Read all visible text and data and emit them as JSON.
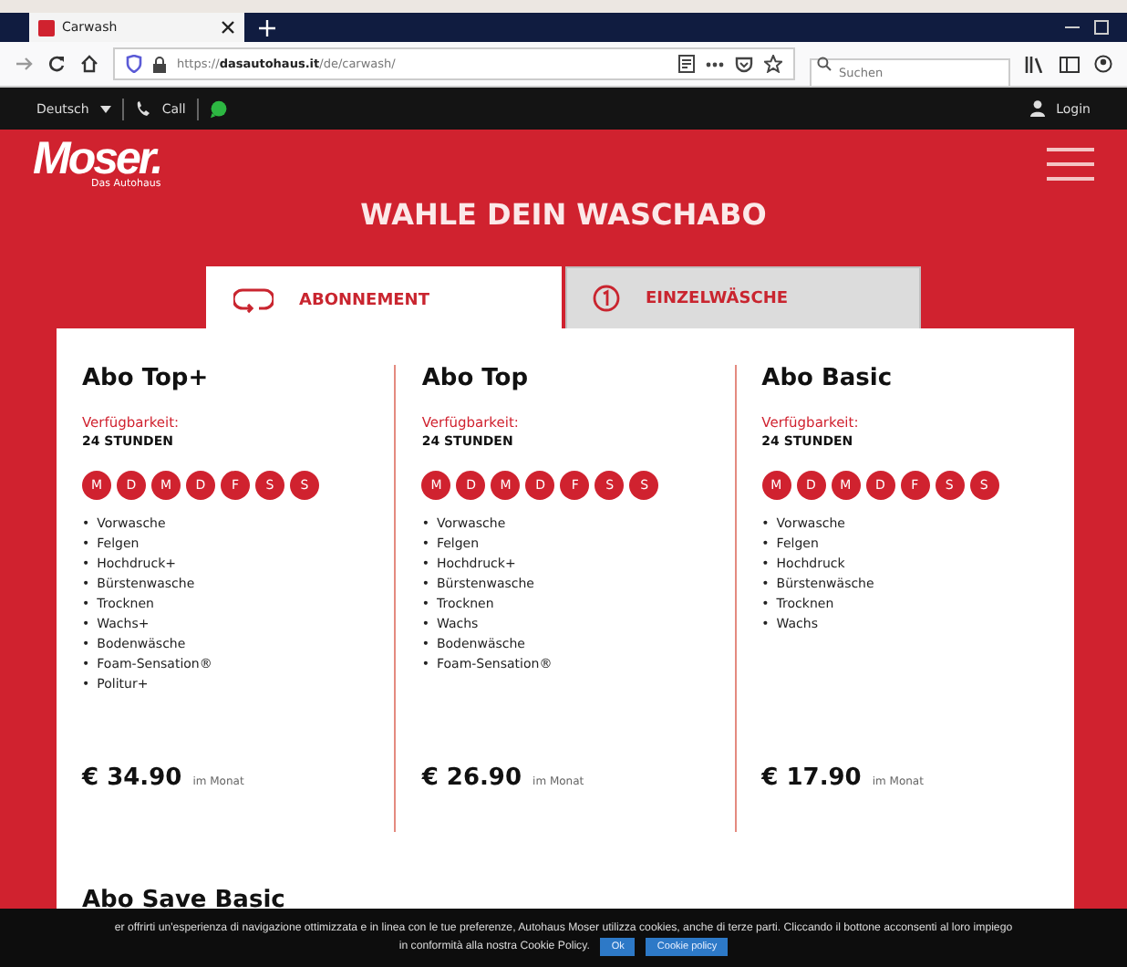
{
  "browser": {
    "tab_title": "Carwash",
    "url": "https://**dasautohaus.it**/de/carwash/",
    "search_placeholder": "Suchen"
  },
  "site_nav": {
    "language": "Deutsch",
    "call": "Call",
    "login": "Login"
  },
  "logo": {
    "name": "Moser.",
    "tagline": "Das Autohaus"
  },
  "title": "WAHLE DEIN WASCHABO",
  "bullet": "•",
  "tabs": [
    {
      "label": "ABONNEMENT",
      "kind": "repeat",
      "selected": true
    },
    {
      "label": "EINZELWÄSCHE",
      "kind": "single",
      "selected": false
    }
  ],
  "plans": [
    {
      "name": "Abo Top+",
      "availability_label": "Verfügbarkeit:",
      "availability": "24 STUNDEN",
      "days": [
        "M",
        "D",
        "M",
        "D",
        "F",
        "S",
        "S"
      ],
      "features": [
        "Vorwasche",
        "Felgen",
        "Hochdruck+",
        "Bürstenwasche",
        "Trocknen",
        "Wachs+",
        "Bodenwäsche",
        "Foam-Sensation®",
        "Politur+"
      ],
      "price": "€ 34.90",
      "period": "im Monat"
    },
    {
      "name": "Abo Top",
      "availability_label": "Verfügbarkeit:",
      "availability": "24 STUNDEN",
      "days": [
        "M",
        "D",
        "M",
        "D",
        "F",
        "S",
        "S"
      ],
      "features": [
        "Vorwasche",
        "Felgen",
        "Hochdruck+",
        "Bürstenwasche",
        "Trocknen",
        "Wachs",
        "Bodenwäsche",
        "Foam-Sensation®"
      ],
      "price": "€ 26.90",
      "period": "im Monat"
    },
    {
      "name": "Abo Basic",
      "availability_label": "Verfügbarkeit:",
      "availability": "24 STUNDEN",
      "days": [
        "M",
        "D",
        "M",
        "D",
        "F",
        "S",
        "S"
      ],
      "features": [
        "Vorwasche",
        "Felgen",
        "Hochdruck",
        "Bürstenwäsche",
        "Trocknen",
        "Wachs"
      ],
      "price": "€ 17.90",
      "period": "im Monat"
    }
  ],
  "next_plan": "Abo Save Basic",
  "cookie_bar": {
    "line_1": "er offrirti un'esperienza di navigazione ottimizzata e in linea con le tue preferenze, Autohaus Moser utilizza cookies, anche di terze parti. Cliccando il bottone acconsenti al loro impiego",
    "line_2": "in conformità alla nostra Cookie Policy.",
    "ok": "Ok",
    "policy": "Cookie policy"
  }
}
